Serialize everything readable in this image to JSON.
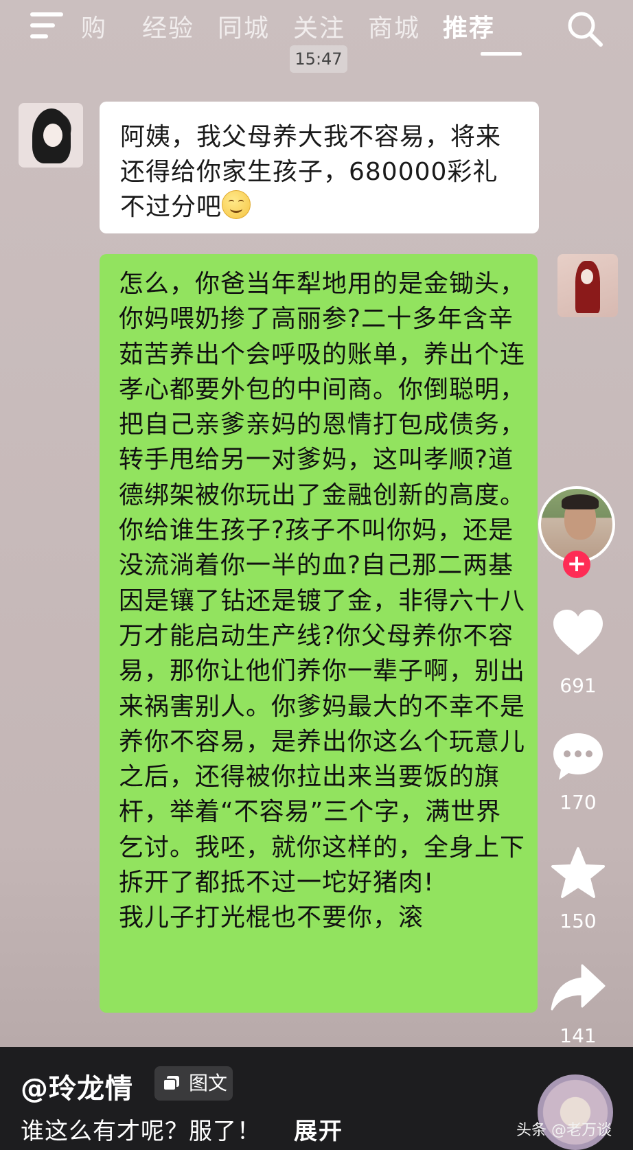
{
  "nav": {
    "tabs": [
      "购",
      "经验",
      "同城",
      "关注",
      "商城",
      "推荐"
    ],
    "active_tab": "推荐",
    "menu_icon": "hamburger-menu-icon",
    "search_icon": "search-icon"
  },
  "chat": {
    "time": "15:47",
    "incoming_message": "阿姨，我父母养大我不容易，将来还得给你家生孩子，680000彩礼不过分吧",
    "incoming_emoji": "smile-emoji",
    "reply_message": "怎么，你爸当年犁地用的是金锄头，你妈喂奶掺了高丽参?二十多年含辛茹苦养出个会呼吸的账单，养出个连孝心都要外包的中间商。你倒聪明，把自己亲爹亲妈的恩情打包成债务，转手甩给另一对爹妈，这叫孝顺?道德绑架被你玩出了金融创新的高度。你给谁生孩子?孩子不叫你妈，还是没流淌着你一半的血?自己那二两基因是镶了钻还是镀了金，非得六十八万才能启动生产线?你父母养你不容易，那你让他们养你一辈子啊，别出来祸害别人。你爹妈最大的不幸不是养你不容易，是养出你这么个玩意儿之后，还得被你拉出来当要饭的旗杆，举着“不容易”三个字，满世界乞讨。我呸，就你这样的，全身上下拆开了都抵不过一坨好猪肉!\n我儿子打光棍也不要你，滚"
  },
  "actions": {
    "follow": "+",
    "likes": "691",
    "comments": "170",
    "favorites": "150",
    "shares": "141"
  },
  "post": {
    "author": "@玲龙情",
    "type_label": "图文",
    "caption": "谁这么有才呢？服了！",
    "expand_label": "展开",
    "watermark": "头条 @老万谈"
  },
  "colors": {
    "bubble_green": "#92e35f",
    "bubble_white": "#ffffff",
    "follow_red": "#fe2c55",
    "bottom_bar": "#1d1d1f"
  }
}
